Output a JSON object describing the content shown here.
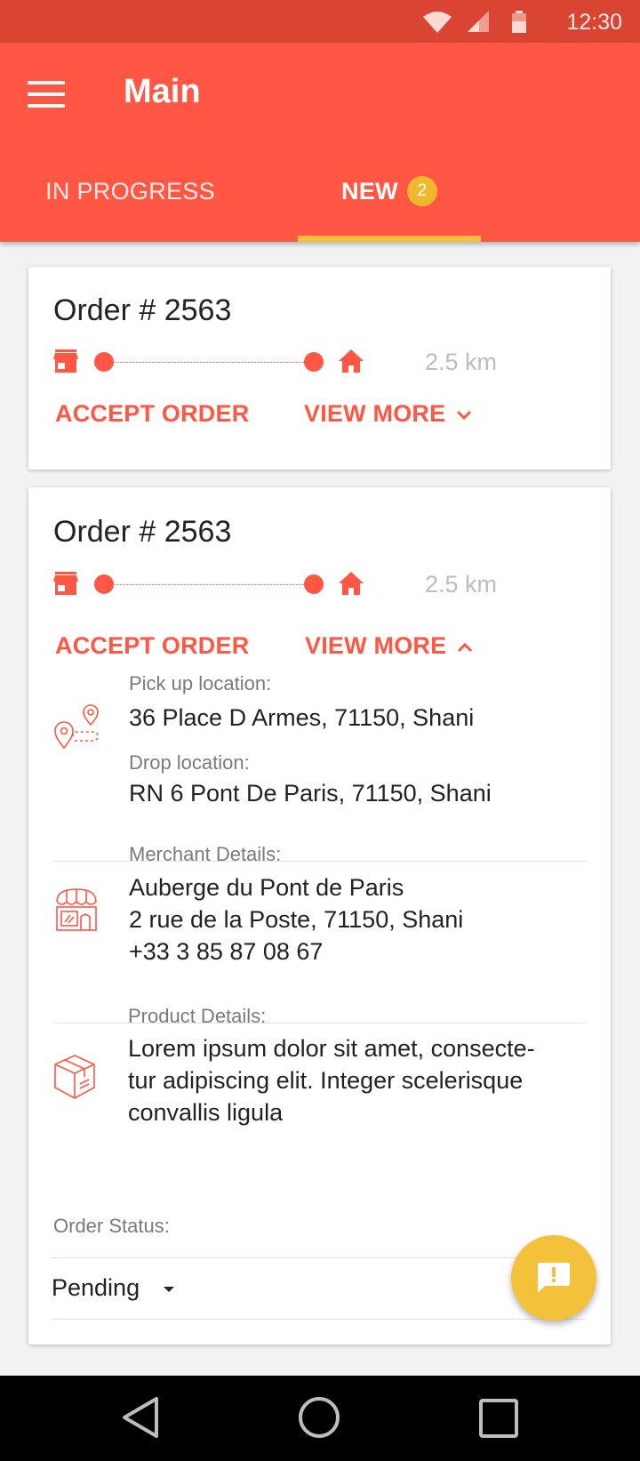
{
  "status_bar": {
    "time": "12:30",
    "icons": [
      "wifi-icon",
      "signal-icon",
      "battery-icon"
    ]
  },
  "app_bar": {
    "title": "Main",
    "menu_icon": "hamburger-menu-icon"
  },
  "tabs": [
    {
      "label": "IN PROGRESS",
      "active": false
    },
    {
      "label": "NEW",
      "badge": "2",
      "active": true
    }
  ],
  "orders": [
    {
      "title": "Order # 2563",
      "distance": "2.5 km",
      "accept_label": "ACCEPT ORDER",
      "view_more_label": "VIEW MORE",
      "expanded": false
    },
    {
      "title": "Order # 2563",
      "distance": "2.5 km",
      "accept_label": "ACCEPT ORDER",
      "view_more_label": "VIEW MORE",
      "expanded": true,
      "details": {
        "pickup_label": "Pick up location:",
        "pickup_value": "36 Place D Armes, 71150, Shani",
        "drop_label": "Drop location:",
        "drop_value": "RN 6 Pont De Paris, 71150, Shani",
        "merchant_label": "Merchant Details:",
        "merchant_name": "Auberge du Pont de Paris",
        "merchant_address": "2 rue de la Poste, 71150, Shani",
        "merchant_phone": "+33 3 85 87 08 67",
        "product_label": "Product Details:",
        "product_line1": "Lorem ipsum dolor sit amet, consecte-",
        "product_line2": "tur adipiscing elit. Integer scelerisque",
        "product_line3": "convallis ligula",
        "status_label": "Order Status:",
        "status_value": "Pending"
      }
    }
  ],
  "colors": {
    "primary": "#ff5744",
    "status_bar": "#d94532",
    "accent": "#f3c13a"
  }
}
